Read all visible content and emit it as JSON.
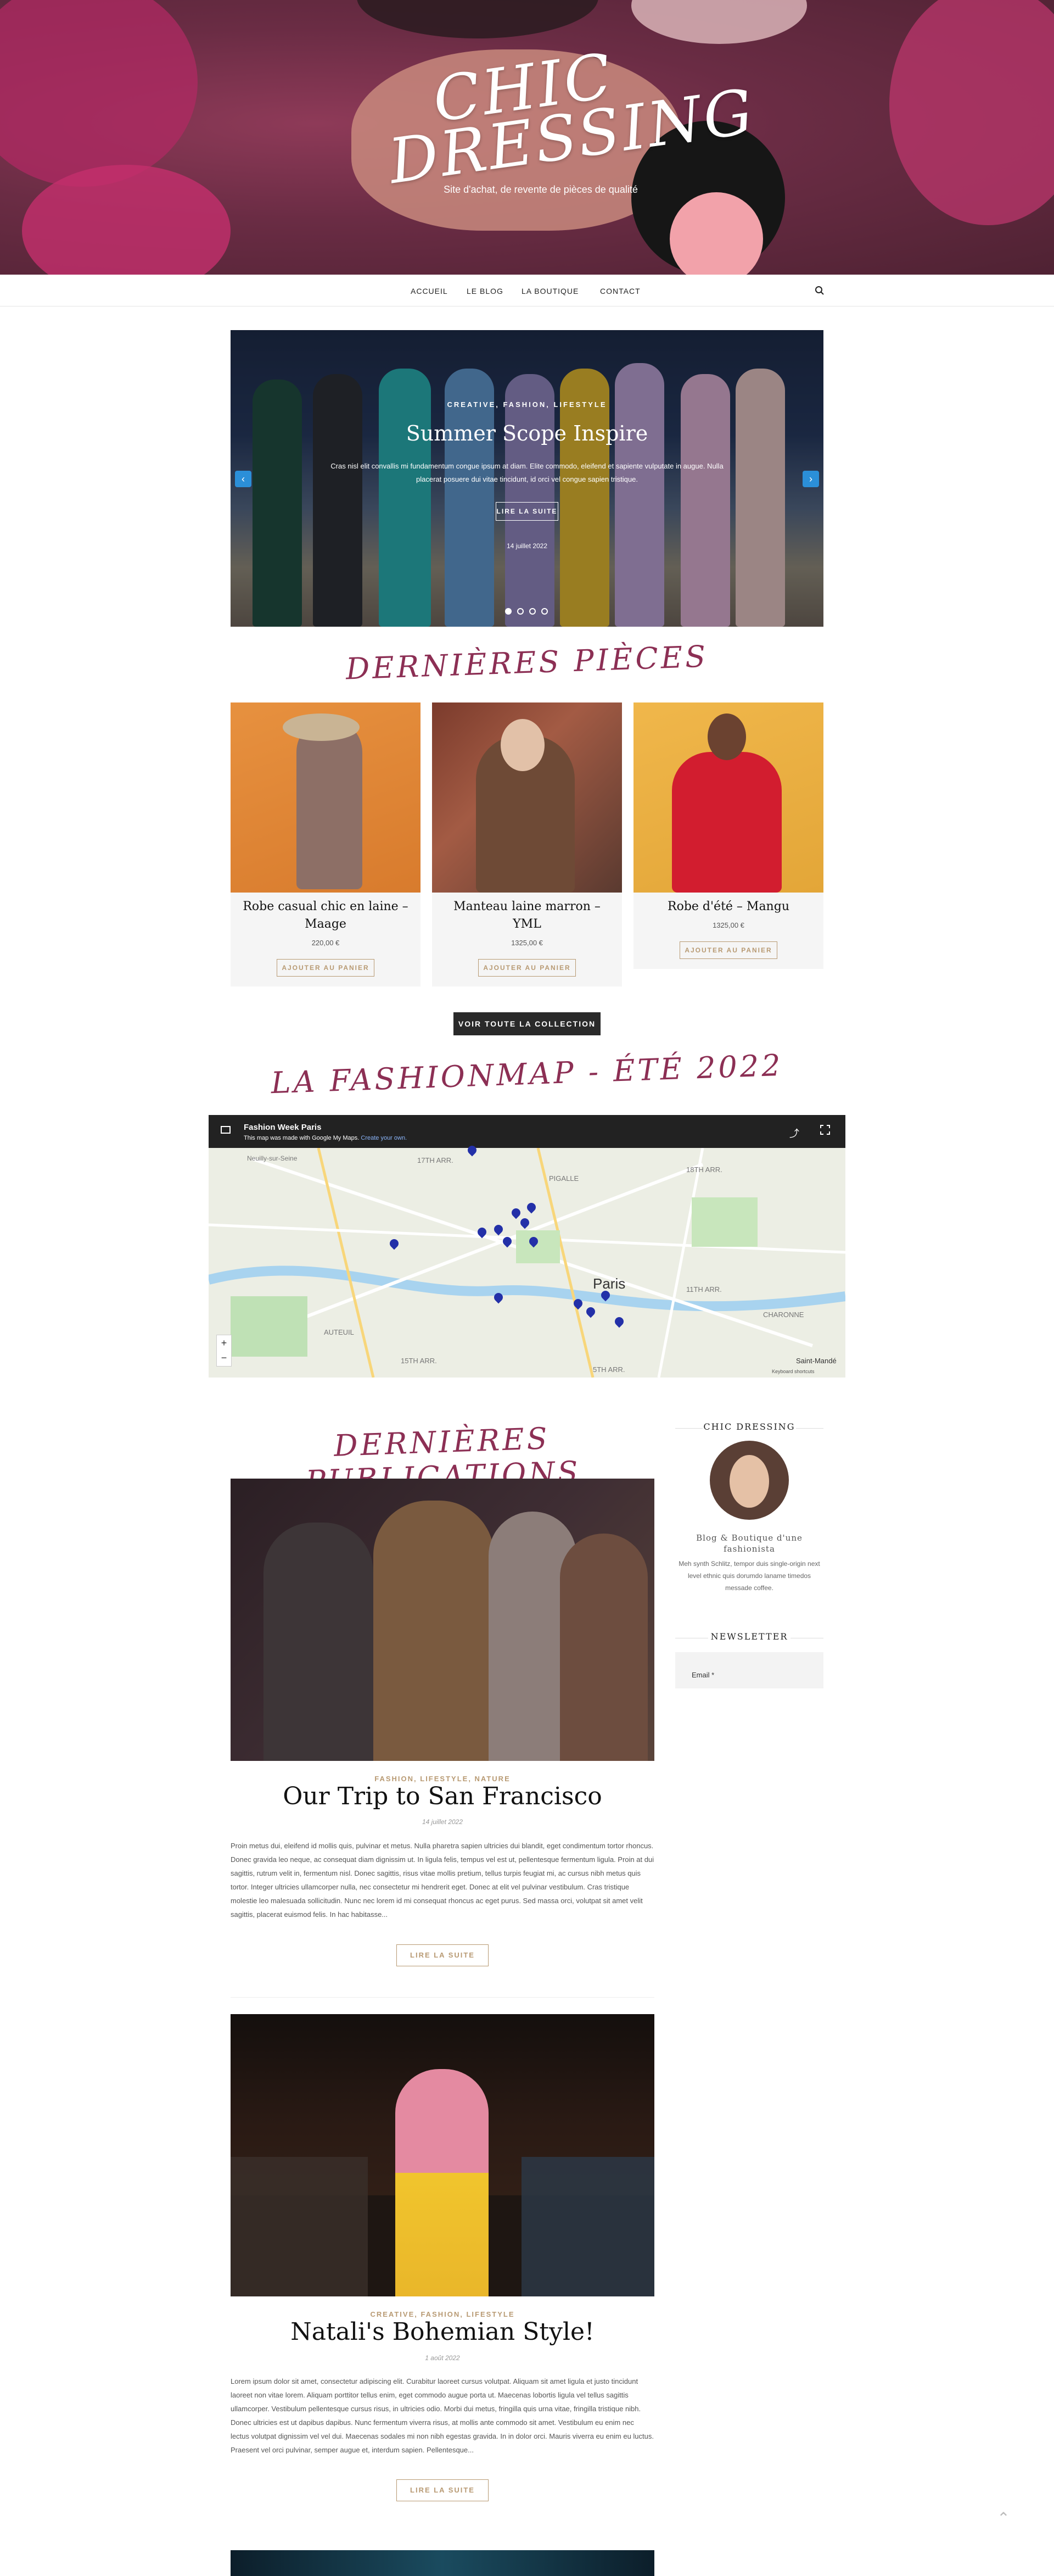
{
  "site": {
    "title_line1": "CHIC",
    "title_line2": "DRESSING",
    "tagline": "Site d'achat, de revente de pièces de qualité"
  },
  "nav": {
    "items": [
      "ACCUEIL",
      "LE BLOG",
      "LA BOUTIQUE",
      "CONTACT"
    ],
    "search_icon": "search-icon"
  },
  "slider": {
    "categories": "CREATIVE, FASHION, LIFESTYLE",
    "title": "Summer Scope Inspire",
    "excerpt": "Cras nisl elit convallis mi fundamentum congue ipsum at diam. Elite commodo, eleifend et sapiente vulputate in augue. Nulla placerat posuere dui vitae tincidunt, id orci vel congue sapien tristique.",
    "button": "LIRE LA SUITE",
    "date": "14 juillet 2022",
    "slides_count": 4,
    "active_slide": 1,
    "prev_icon": "chevron-left-icon",
    "next_icon": "chevron-right-icon"
  },
  "latest_pieces": {
    "title": "DERNIÈRES PIÈCES",
    "products": [
      {
        "name": "Robe casual chic en laine – Maage",
        "price": "220,00 €",
        "button": "AJOUTER AU PANIER"
      },
      {
        "name": "Manteau laine marron – YML",
        "price": "1325,00 €",
        "button": "AJOUTER AU PANIER"
      },
      {
        "name": "Robe d'été – Mangu",
        "price": "1325,00 €",
        "button": "AJOUTER AU PANIER"
      }
    ],
    "collection_button": "VOIR TOUTE LA COLLECTION"
  },
  "fashionmap": {
    "title": "LA FASHIONMAP - ÉTÉ 2022",
    "map_title": "Fashion Week Paris",
    "map_notice": "This map was made with Google My Maps.",
    "map_notice_link": "Create your own.",
    "labels": [
      "17TH ARR.",
      "18TH ARR.",
      "PIGALLE",
      "Paris",
      "11TH ARR.",
      "15TH ARR.",
      "AUTEUIL",
      "CHARONNE",
      "Saint-Mandé",
      "Neuilly-sur-Seine",
      "5TH ARR."
    ],
    "footer_text": "Keyboard shortcuts"
  },
  "latest_posts": {
    "title": "DERNIÈRES PUBLICATIONS",
    "posts": [
      {
        "categories": "FASHION, LIFESTYLE, NATURE",
        "title": "Our Trip to San Francisco",
        "date": "14 juillet 2022",
        "excerpt": "Proin metus dui, eleifend id mollis quis, pulvinar et metus. Nulla pharetra sapien ultricies dui blandit, eget condimentum tortor rhoncus. Donec gravida leo neque, ac consequat diam dignissim ut. In ligula felis, tempus vel est ut, pellentesque fermentum ligula. Proin at dui sagittis, rutrum velit in, fermentum nisl. Donec sagittis, risus vitae mollis pretium, tellus turpis feugiat mi, ac cursus nibh metus quis tortor. Integer ultricies ullamcorper nulla, nec consectetur mi hendrerit eget. Donec at elit vel pulvinar vestibulum. Cras tristique molestie leo malesuada sollicitudin. Nunc nec lorem id mi consequat rhoncus ac eget purus. Sed massa orci, volutpat sit amet velit sagittis, placerat euismod felis. In hac habitasse...",
        "button": "LIRE LA SUITE"
      },
      {
        "categories": "CREATIVE, FASHION, LIFESTYLE",
        "title": "Natali's Bohemian Style!",
        "date": "1 août 2022",
        "excerpt": "Lorem ipsum dolor sit amet, consectetur adipiscing elit. Curabitur laoreet cursus volutpat. Aliquam sit amet ligula et justo tincidunt laoreet non vitae lorem. Aliquam porttitor tellus enim, eget commodo augue porta ut. Maecenas lobortis ligula vel tellus sagittis ullamcorper. Vestibulum pellentesque cursus risus, in ultricies odio. Morbi dui metus, fringilla quis urna vitae, fringilla tristique nibh. Donec ultricies est ut dapibus dapibus. Nunc fermentum viverra risus, at mollis ante commodo sit amet. Vestibulum eu enim nec lectus volutpat dignissim vel vel dui. Maecenas sodales mi non nibh egestas gravida. In in dolor orci. Mauris viverra eu enim eu luctus. Praesent vel orci pulvinar, semper augue et, interdum sapien. Pellentesque...",
        "button": "LIRE LA SUITE"
      }
    ]
  },
  "sidebar": {
    "about_title": "CHIC DRESSING",
    "about_subtitle": "Blog & Boutique d'une fashionista",
    "about_text": "Meh synth Schlitz, tempor duis single-origin next level ethnic quis dorumdo laname timedos messade coffee.",
    "newsletter_title": "NEWSLETTER",
    "email_label": "Email *"
  },
  "colors": {
    "accent": "#8c2f54",
    "gold": "#b89a73"
  }
}
